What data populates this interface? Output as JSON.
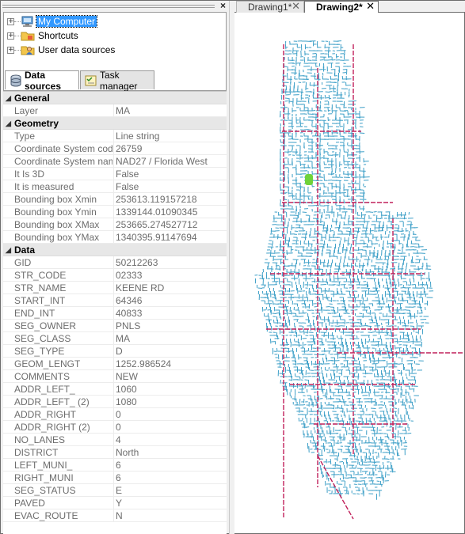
{
  "tree": {
    "items": [
      {
        "label": "My Computer",
        "icon": "computer-icon",
        "selected": true
      },
      {
        "label": "Shortcuts",
        "icon": "folder-icon",
        "selected": false
      },
      {
        "label": "User data sources",
        "icon": "user-data-icon",
        "selected": false
      }
    ]
  },
  "tabs": {
    "data_sources": "Data sources",
    "task_manager": "Task manager"
  },
  "properties": {
    "general": {
      "title": "General",
      "rows": [
        {
          "key": "Layer",
          "value": "MA"
        }
      ]
    },
    "geometry": {
      "title": "Geometry",
      "rows": [
        {
          "key": "Type",
          "value": "Line string"
        },
        {
          "key": "Coordinate System code",
          "value": "26759"
        },
        {
          "key": "Coordinate System name",
          "value": "NAD27 / Florida West"
        },
        {
          "key": "It Is 3D",
          "value": "False"
        },
        {
          "key": "It is measured",
          "value": "False"
        },
        {
          "key": "Bounding box Xmin",
          "value": "253613.119157218"
        },
        {
          "key": "Bounding box Ymin",
          "value": "1339144.01090345"
        },
        {
          "key": "Bounding box XMax",
          "value": "253665.274527712"
        },
        {
          "key": "Bounding box YMax",
          "value": "1340395.91147694"
        }
      ]
    },
    "data": {
      "title": "Data",
      "rows": [
        {
          "key": "GID",
          "value": "50212263"
        },
        {
          "key": "STR_CODE",
          "value": "02333"
        },
        {
          "key": "STR_NAME",
          "value": "KEENE RD"
        },
        {
          "key": "START_INT",
          "value": "64346"
        },
        {
          "key": "END_INT",
          "value": "40833"
        },
        {
          "key": "SEG_OWNER",
          "value": "PNLS"
        },
        {
          "key": "SEG_CLASS",
          "value": "MA"
        },
        {
          "key": "SEG_TYPE",
          "value": "D"
        },
        {
          "key": "GEOM_LENGT",
          "value": "1252.986524"
        },
        {
          "key": "COMMENTS",
          "value": "NEW"
        },
        {
          "key": "ADDR_LEFT_",
          "value": "1060"
        },
        {
          "key": "ADDR_LEFT_ (2)",
          "value": "1080"
        },
        {
          "key": "ADDR_RIGHT",
          "value": "0"
        },
        {
          "key": "ADDR_RIGHT (2)",
          "value": "0"
        },
        {
          "key": "NO_LANES",
          "value": "4"
        },
        {
          "key": "DISTRICT",
          "value": "North"
        },
        {
          "key": "LEFT_MUNI_",
          "value": "6"
        },
        {
          "key": "RIGHT_MUNI",
          "value": "6"
        },
        {
          "key": "SEG_STATUS",
          "value": "E"
        },
        {
          "key": "PAVED",
          "value": "Y"
        },
        {
          "key": "EVAC_ROUTE",
          "value": "N"
        }
      ]
    }
  },
  "documents": {
    "tabs": [
      {
        "label": "Drawing1*",
        "active": false
      },
      {
        "label": "Drawing2*",
        "active": true
      }
    ]
  },
  "map": {
    "road_color": "#3d9fc7",
    "major_road_color": "#c0205a",
    "highlight_color": "#6fd23a"
  }
}
